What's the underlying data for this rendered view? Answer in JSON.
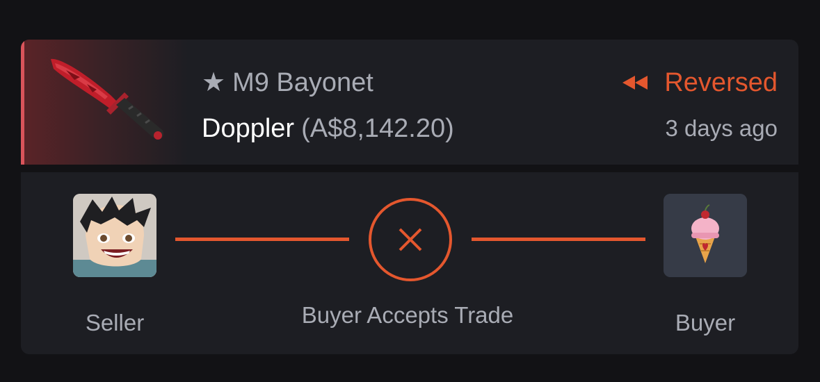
{
  "item": {
    "name": "M9 Bayonet",
    "phase": "Doppler",
    "price": "(A$8,142.20)",
    "status": "Reversed",
    "time_ago": "3 days ago",
    "icon": "star-icon"
  },
  "trade": {
    "seller_label": "Seller",
    "buyer_label": "Buyer",
    "step_label": "Buyer Accepts Trade",
    "step_icon": "close-icon"
  },
  "colors": {
    "accent": "#e4572e",
    "card": "#1d1e23",
    "background": "#121215",
    "muted_text": "#a9acb5",
    "rarity": "#d9545b"
  }
}
